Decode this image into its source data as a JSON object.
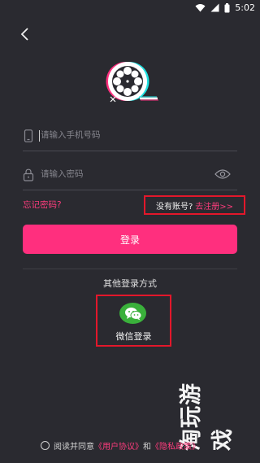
{
  "status": {
    "time": "5:02"
  },
  "login": {
    "phone_placeholder": "请输入手机号码",
    "password_placeholder": "请输入密码",
    "forgot_label": "忘记密码?",
    "no_account_label": "没有账号?",
    "register_link": "去注册>>",
    "login_button": "登录"
  },
  "other_login": {
    "title": "其他登录方式",
    "wechat_label": "微信登录"
  },
  "agreement": {
    "prefix": "阅读并同意",
    "user_agreement": "《用户协议》",
    "and": "和",
    "privacy_policy": "《隐私政策》"
  },
  "watermark": {
    "text": "淘玩游戏"
  },
  "colors": {
    "background": "#2a2a30",
    "accent": "#ff2f7e",
    "link": "#ff3c7d",
    "highlight_border": "#e3172b",
    "wechat_green": "#3ab03b"
  },
  "icons": [
    "wifi-icon",
    "signal-icon",
    "battery-icon",
    "back-arrow-icon",
    "film-reel-logo-icon",
    "phone-icon",
    "lock-icon",
    "eye-icon",
    "wechat-icon",
    "radio-icon"
  ]
}
